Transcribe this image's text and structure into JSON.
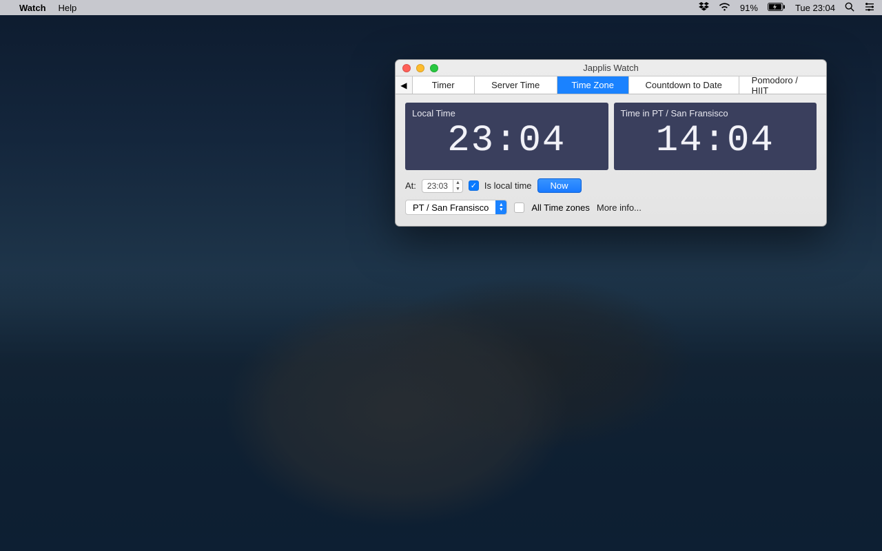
{
  "menubar": {
    "app_name": "Watch",
    "menus": [
      "Help"
    ],
    "battery_pct": "91%",
    "clock": "Tue 23:04"
  },
  "window": {
    "title": "Japplis Watch",
    "tabs": {
      "back_glyph": "◀",
      "items": [
        "Timer",
        "Server Time",
        "Time Zone",
        "Countdown to Date",
        "Pomodoro / HIIT"
      ],
      "active_index": 2
    },
    "panels": {
      "local": {
        "label": "Local Time",
        "time": "23:04"
      },
      "remote": {
        "label": "Time in PT / San Fransisco",
        "time": "14:04"
      }
    },
    "controls": {
      "at_label": "At:",
      "at_value": "23:03",
      "is_local_label": "Is local time",
      "is_local_checked": true,
      "now_label": "Now",
      "timezone_selected": "PT / San Fransisco",
      "all_tz_label": "All Time zones",
      "all_tz_checked": false,
      "more_info_label": "More info..."
    }
  }
}
